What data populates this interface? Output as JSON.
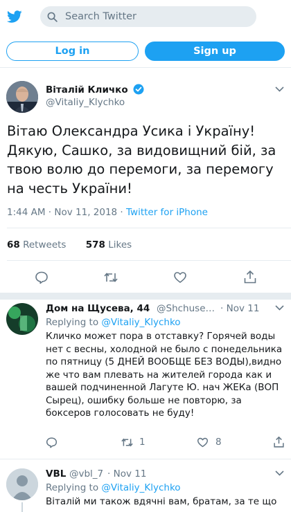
{
  "header": {
    "logo_icon": "twitter-bird-icon",
    "search_placeholder": "Search Twitter",
    "brand_color": "#1da1f2"
  },
  "auth": {
    "login_label": "Log in",
    "signup_label": "Sign up"
  },
  "tweet": {
    "author_name": "Віталій Кличко",
    "verified_icon": "verified-badge-icon",
    "author_handle": "@Vitaliy_Klychko",
    "text": "Вітаю Олександра Усика і Україну! Дякую, Сашко, за видовищний бій, за твою волю до перемоги, за перемогу на честь України!",
    "time": "1:44 AM",
    "date": "Nov 11, 2018",
    "source": "Twitter for iPhone",
    "retweets_count": "68",
    "retweets_label": "Retweets",
    "likes_count": "578",
    "likes_label": "Likes",
    "actions": [
      "reply-icon",
      "retweet-icon",
      "like-icon",
      "share-icon"
    ]
  },
  "replies": [
    {
      "author_name": "Дом на Щусева, 44",
      "author_handle": "@Shchuse…",
      "date": "Nov 11",
      "replying_label": "Replying to",
      "replying_handle": "@Vitaliy_Klychko",
      "text": "Кличко может пора в отставку? Горячей воды нет с весны, холодной не было с понедельника по пятницу (5 ДНЕЙ ВООБЩЕ БЕЗ ВОДЫ),видно же что вам плевать на жителей города как и вашей подчиненной Лагуте Ю. нач ЖЕКа (ВОП Сырец), ошибку больше не повторю, за боксеров голосовать не буду!",
      "reply_count": "",
      "retweet_count": "1",
      "like_count": "8"
    },
    {
      "author_name": "VBL",
      "author_handle": "@vbl_7",
      "date": "Nov 11",
      "replying_label": "Replying to",
      "replying_handle": "@Vitaliy_Klychko",
      "text": "Віталій ми також вдячні вам, братам, за те що"
    }
  ]
}
